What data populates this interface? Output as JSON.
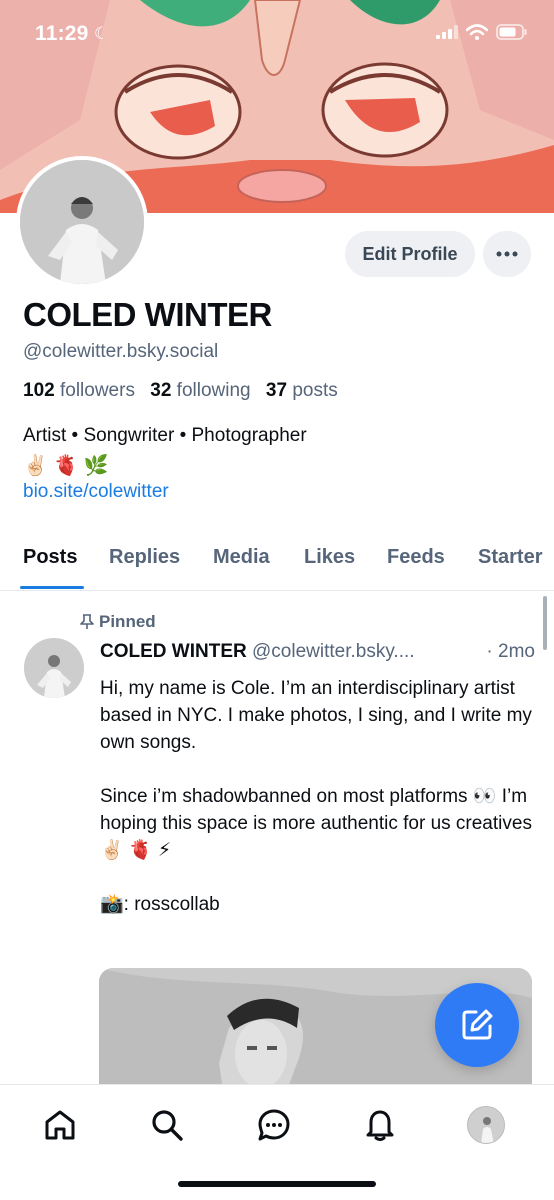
{
  "status_bar": {
    "time": "11:29",
    "moon": "☾"
  },
  "profile": {
    "name": "COLED WINTER",
    "handle": "@colewitter.bsky.social",
    "followers_count": "102",
    "followers_label": "followers",
    "following_count": "32",
    "following_label": "following",
    "posts_count": "37",
    "posts_label": "posts",
    "bio_line1": "Artist • Songwriter • Photographer",
    "bio_emojis": "✌🏻 🫀 🌿",
    "bio_link": "bio.site/colewitter"
  },
  "actions": {
    "edit_profile": "Edit Profile",
    "more": "•••"
  },
  "tabs": [
    {
      "label": "Posts",
      "active": true
    },
    {
      "label": "Replies"
    },
    {
      "label": "Media"
    },
    {
      "label": "Likes"
    },
    {
      "label": "Feeds"
    },
    {
      "label": "Starter"
    }
  ],
  "post": {
    "pinned_label": "Pinned",
    "author": "COLED WINTER",
    "handle": "@colewitter.bsky....",
    "time": "· 2mo",
    "paragraph1": "Hi, my name is Cole. I’m an interdisciplinary artist based in NYC. I make photos, I sing, and I write my own songs.",
    "paragraph2": "Since i’m shadowbanned on most platforms 👀 I’m hoping this space is more authentic for us creatives ✌🏻 🫀 ⚡",
    "paragraph3": "📸: rosscollab"
  },
  "bottom_nav": {
    "icons": [
      "home-icon",
      "search-icon",
      "chat-icon",
      "bell-icon",
      "avatar"
    ]
  },
  "colors": {
    "accent": "#1a7ce0",
    "fab": "#2f7bf6",
    "muted_text": "#56657a",
    "button_bg": "#eef0f3"
  }
}
